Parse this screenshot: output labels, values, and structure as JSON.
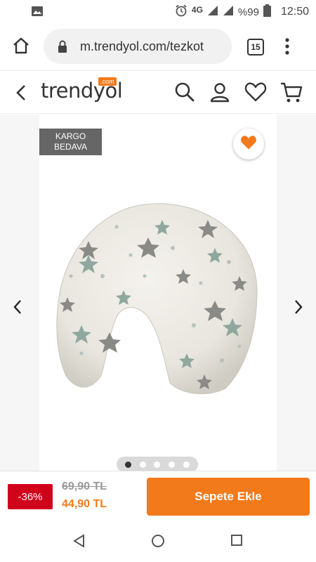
{
  "status_bar": {
    "network": "4G",
    "battery": "%99",
    "time": "12:50"
  },
  "browser": {
    "url": "m.trendyol.com/tezkot",
    "tab_count": "15"
  },
  "header": {
    "logo": "trendyol",
    "logo_badge": ".com"
  },
  "product": {
    "badge_line1": "KARGO",
    "badge_line2": "BEDAVA",
    "image_count": 5,
    "active_image": 1
  },
  "pricing": {
    "discount": "-36%",
    "old_price": "69,90 TL",
    "new_price": "44,90 TL",
    "add_to_cart": "Sepete Ekle"
  },
  "colors": {
    "accent": "#f27a1a",
    "discount_bg": "#d0021b",
    "badge_bg": "#666666"
  }
}
